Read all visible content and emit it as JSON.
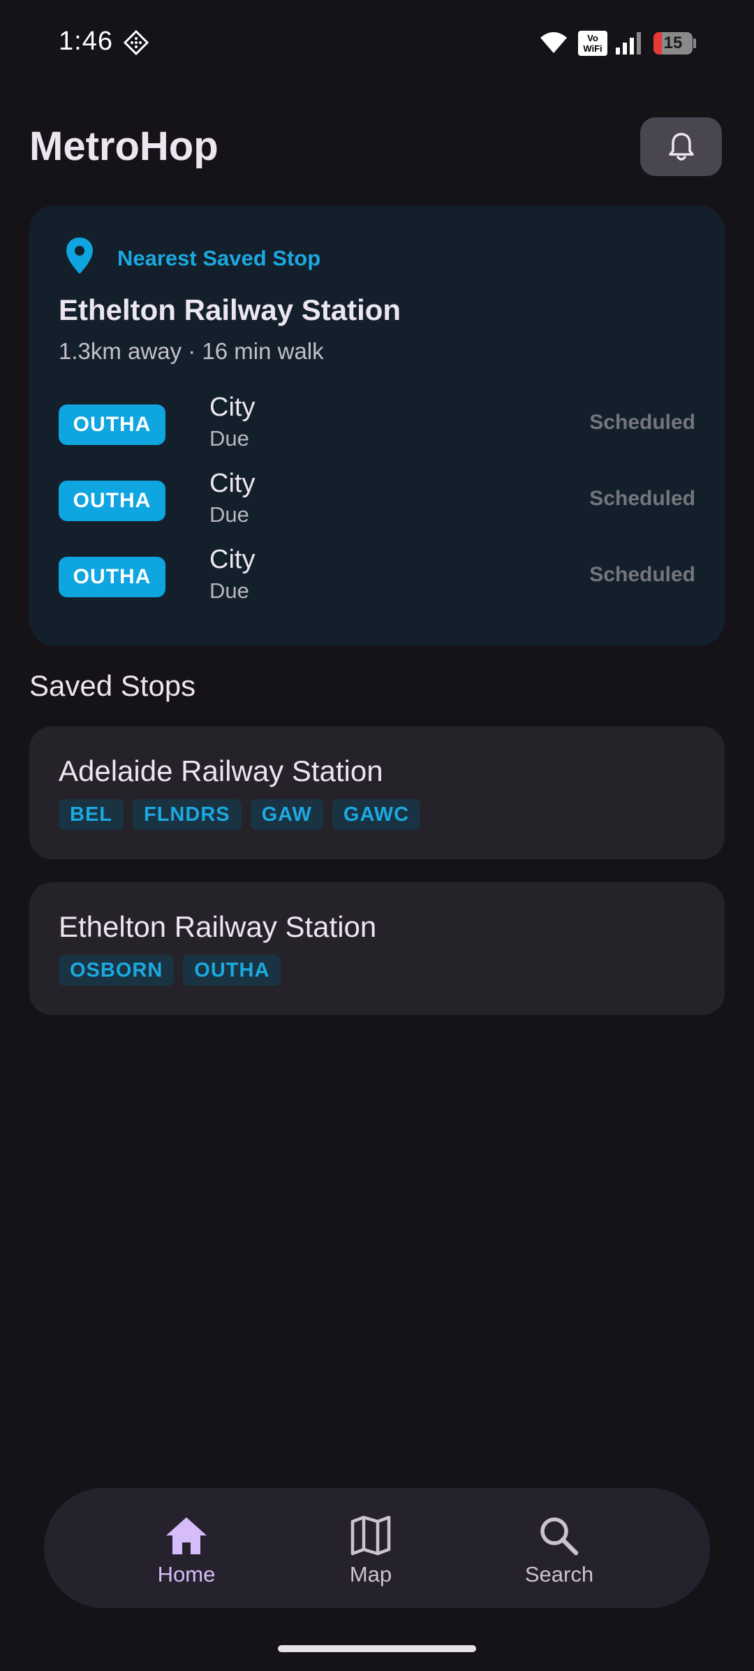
{
  "status_bar": {
    "time": "1:46",
    "vowifi": "Vo\nWiFi",
    "battery": "15",
    "icons": [
      "notification-diamond-icon",
      "wifi-icon",
      "vowifi-icon",
      "signal-icon",
      "battery-icon"
    ]
  },
  "header": {
    "title": "MetroHop",
    "notifications_icon": "bell-icon"
  },
  "nearest": {
    "label": "Nearest Saved Stop",
    "icon": "location-pin-icon",
    "stop_name": "Ethelton Railway Station",
    "distance": "1.3km away · 16 min walk",
    "departures": [
      {
        "route": "OUTHA",
        "destination": "City",
        "due": "Due",
        "status": "Scheduled"
      },
      {
        "route": "OUTHA",
        "destination": "City",
        "due": "Due",
        "status": "Scheduled"
      },
      {
        "route": "OUTHA",
        "destination": "City",
        "due": "Due",
        "status": "Scheduled"
      }
    ]
  },
  "saved": {
    "title": "Saved Stops",
    "stops": [
      {
        "name": "Adelaide Railway Station",
        "routes": [
          "BEL",
          "FLNDRS",
          "GAW",
          "GAWC"
        ]
      },
      {
        "name": "Ethelton Railway Station",
        "routes": [
          "OSBORN",
          "OUTHA"
        ]
      }
    ]
  },
  "nav": {
    "items": [
      {
        "label": "Home",
        "icon": "home-icon",
        "active": true
      },
      {
        "label": "Map",
        "icon": "map-icon",
        "active": false
      },
      {
        "label": "Search",
        "icon": "search-icon",
        "active": false
      }
    ]
  },
  "colors": {
    "background": "#151318",
    "accent": "#0ea5e0",
    "nav_active": "#d7bcfa",
    "card_nearest": "#13202b",
    "card_saved": "#25222a"
  }
}
